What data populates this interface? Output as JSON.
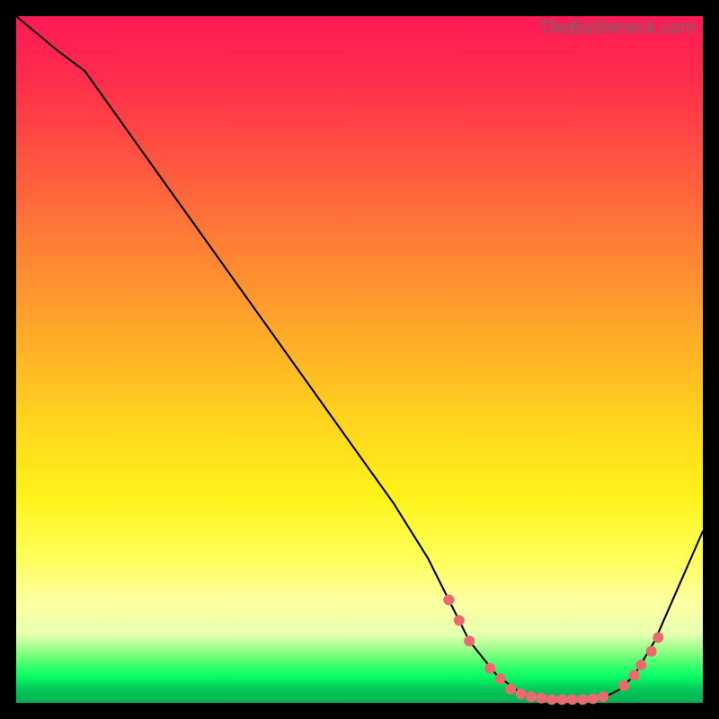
{
  "watermark": "TheBottleneck.com",
  "chart_data": {
    "type": "line",
    "title": "",
    "xlabel": "",
    "ylabel": "",
    "xlim": [
      0,
      100
    ],
    "ylim": [
      0,
      100
    ],
    "series": [
      {
        "name": "bottleneck-curve",
        "x": [
          0,
          6,
          10,
          20,
          30,
          40,
          50,
          55,
          60,
          64,
          66,
          70,
          74,
          78,
          82,
          86,
          88,
          90,
          93,
          100
        ],
        "values": [
          100,
          95,
          92,
          78,
          64,
          50,
          36,
          29,
          21,
          13,
          9,
          4,
          1,
          0.5,
          0.5,
          1,
          2,
          4,
          9,
          25
        ]
      }
    ],
    "dots": {
      "name": "highlighted-points",
      "x": [
        63,
        64.5,
        66,
        69,
        70.5,
        72,
        73.5,
        75,
        76.5,
        78,
        79.5,
        81,
        82.5,
        84,
        85.5,
        88.5,
        90,
        91,
        92.5,
        93.5
      ],
      "values": [
        15,
        12,
        9,
        5,
        3.5,
        2,
        1.3,
        0.9,
        0.7,
        0.5,
        0.5,
        0.5,
        0.5,
        0.6,
        0.9,
        2.5,
        4,
        5.5,
        7.5,
        9.5
      ]
    }
  }
}
